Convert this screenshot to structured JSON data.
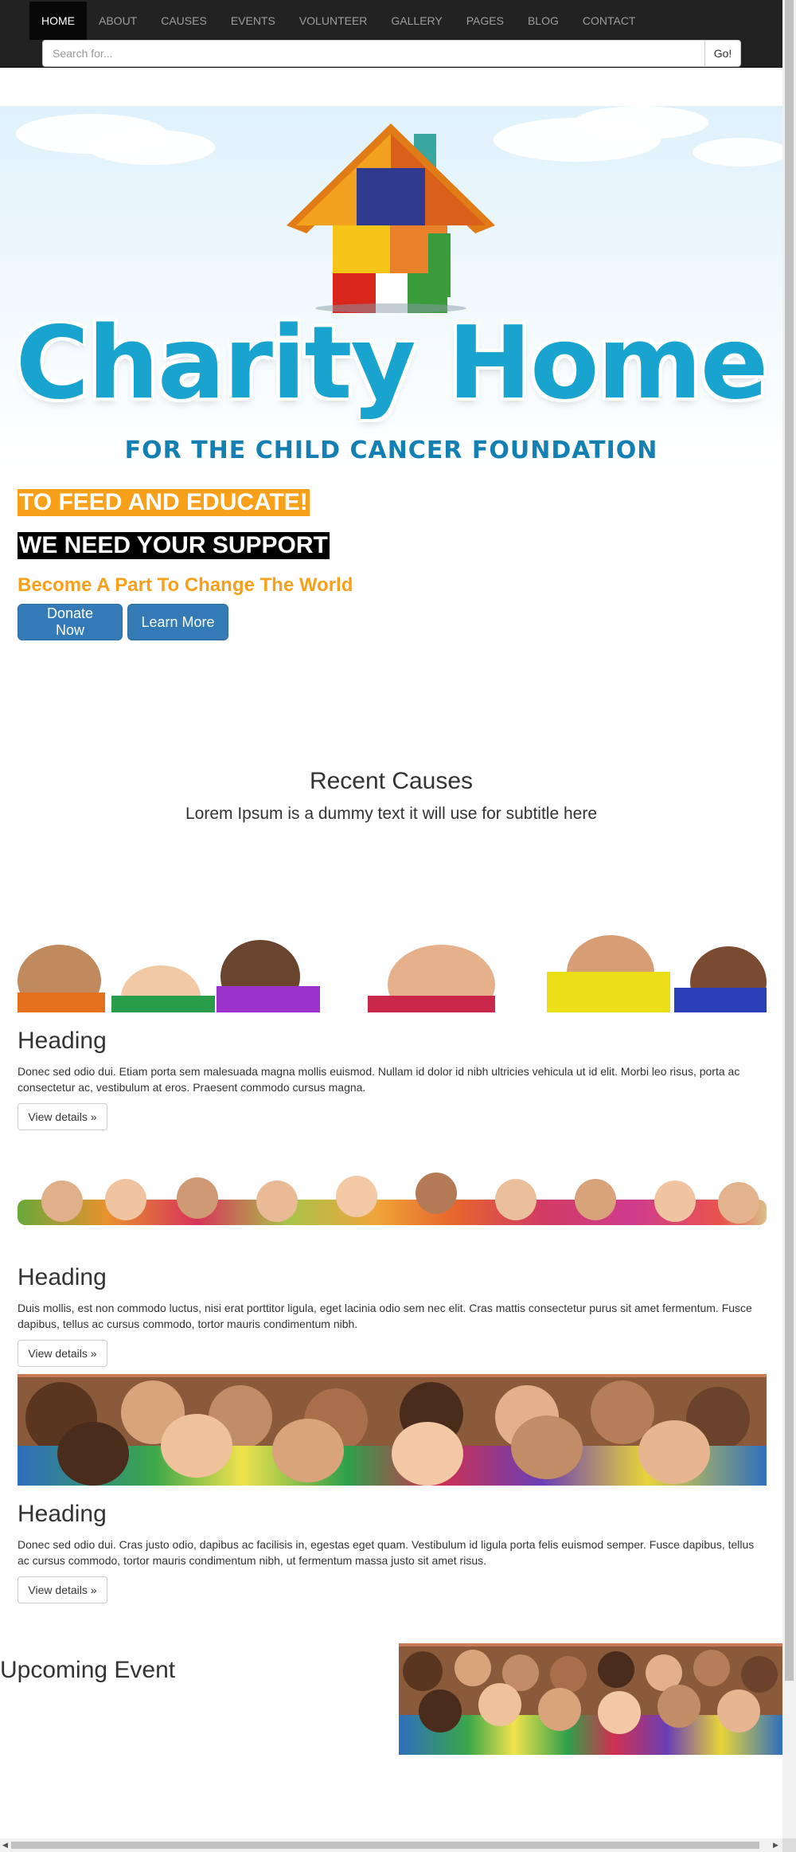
{
  "nav": {
    "items": [
      {
        "label": "HOME",
        "active": true
      },
      {
        "label": "ABOUT"
      },
      {
        "label": "CAUSES"
      },
      {
        "label": "EVENTS"
      },
      {
        "label": "VOLUNTEER"
      },
      {
        "label": "GALLERY"
      },
      {
        "label": "PAGES"
      },
      {
        "label": "BLOG"
      },
      {
        "label": "CONTACT"
      }
    ],
    "search_placeholder": "Search for...",
    "search_button": "Go!"
  },
  "hero": {
    "logo_title": "Charity Home",
    "logo_subtitle": "FOR THE CHILD CANCER FOUNDATION"
  },
  "cta": {
    "headline1": "TO FEED AND EDUCATE!",
    "headline2": "WE NEED YOUR SUPPORT",
    "tagline": "Become A Part To Change The World",
    "donate_label": "Donate Now",
    "learn_label": "Learn More"
  },
  "causes": {
    "title": "Recent Causes",
    "subtitle": "Lorem Ipsum is a dummy text it will use for subtitle here",
    "items": [
      {
        "heading": "Heading",
        "text": "Donec sed odio dui. Etiam porta sem malesuada magna mollis euismod. Nullam id dolor id nibh ultricies vehicula ut id elit. Morbi leo risus, porta ac consectetur ac, vestibulum at eros. Praesent commodo cursus magna.",
        "button": "View details »"
      },
      {
        "heading": "Heading",
        "text": "Duis mollis, est non commodo luctus, nisi erat porttitor ligula, eget lacinia odio sem nec elit. Cras mattis consectetur purus sit amet fermentum. Fusce dapibus, tellus ac cursus commodo, tortor mauris condimentum nibh.",
        "button": "View details »"
      },
      {
        "heading": "Heading",
        "text": "Donec sed odio dui. Cras justo odio, dapibus ac facilisis in, egestas eget quam. Vestibulum id ligula porta felis euismod semper. Fusce dapibus, tellus ac cursus commodo, tortor mauris condimentum nibh, ut fermentum massa justo sit amet risus.",
        "button": "View details »"
      }
    ]
  },
  "events": {
    "title": "Upcoming Event"
  },
  "colors": {
    "navbar": "#222222",
    "accent_orange": "#f9a01b",
    "primary_blue": "#337ab7",
    "logo_blue": "#19a4cf"
  }
}
